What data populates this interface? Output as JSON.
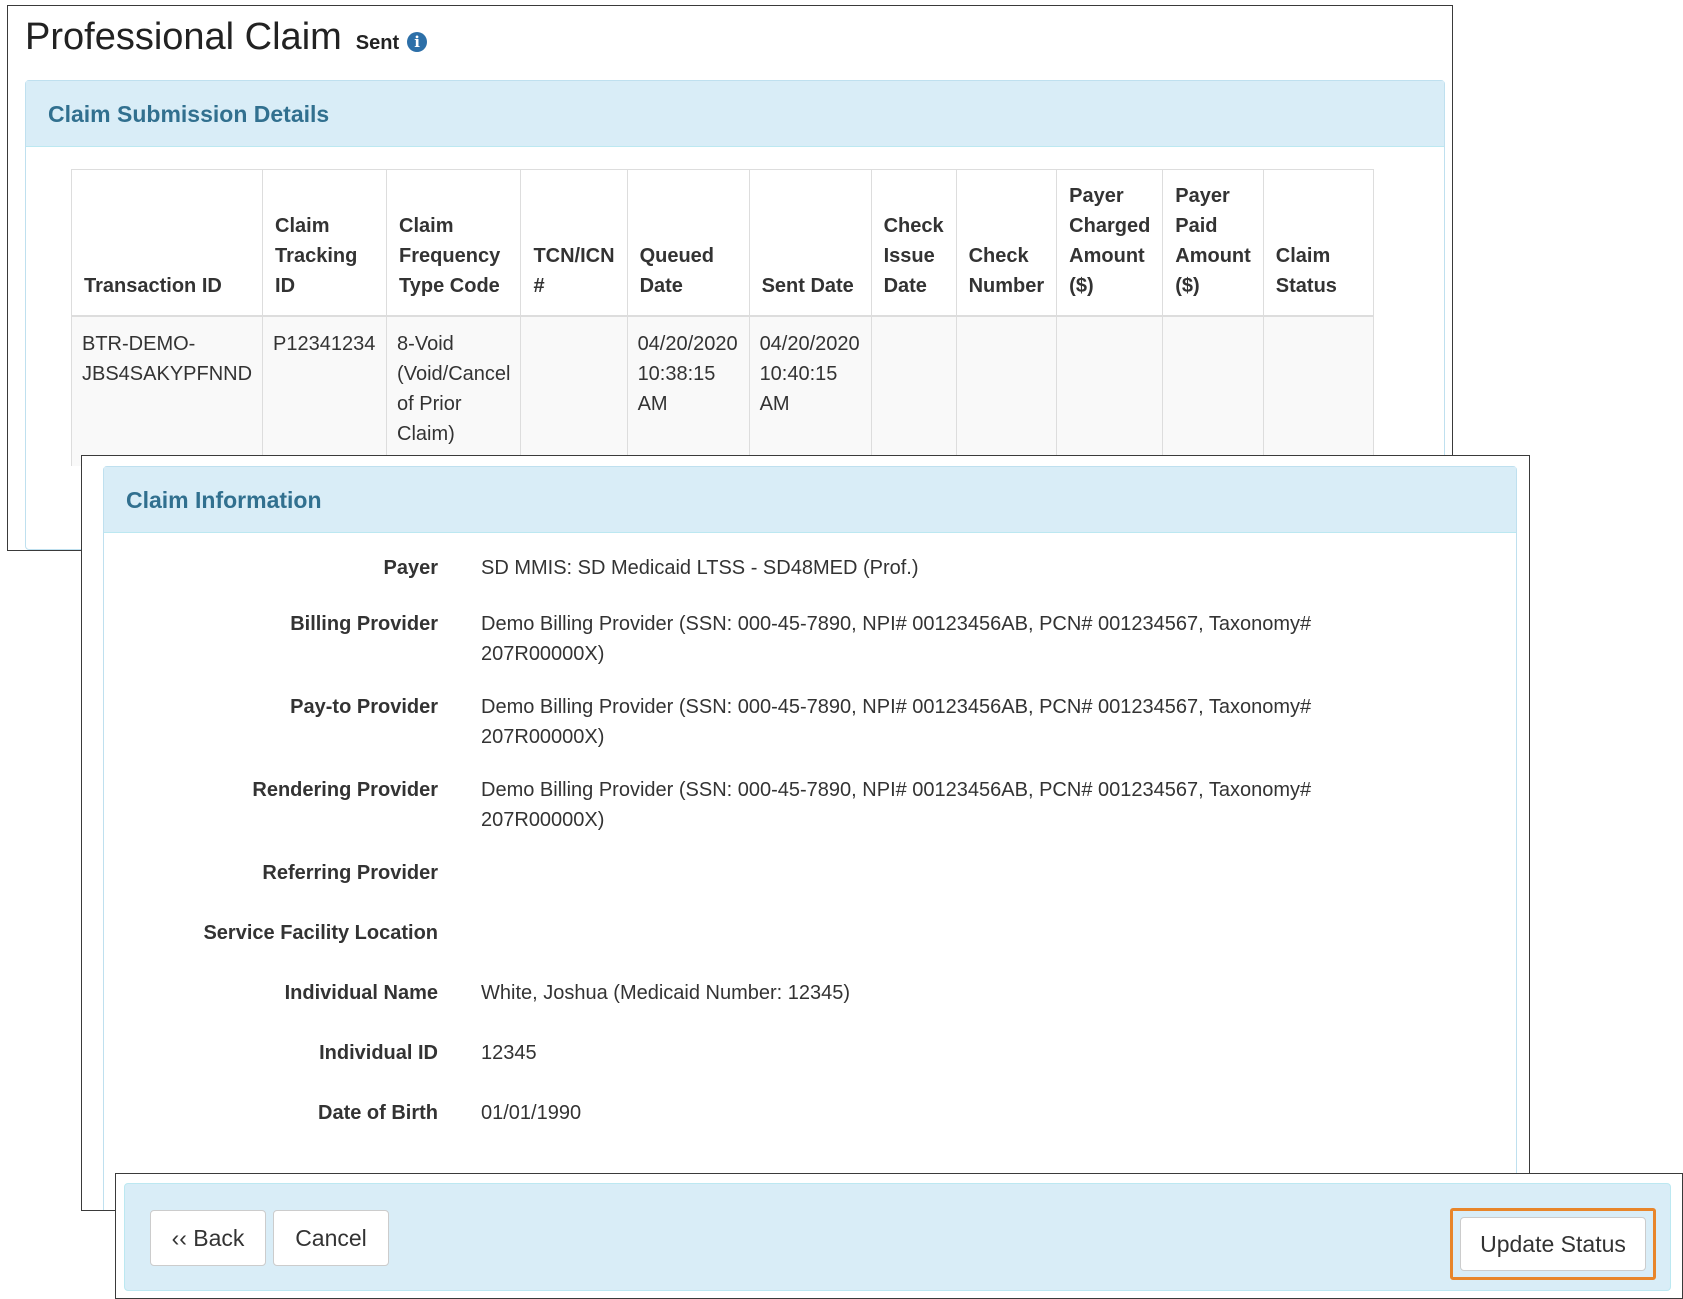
{
  "header": {
    "title": "Professional Claim",
    "status": "Sent",
    "info_icon": "i"
  },
  "submission": {
    "title": "Claim Submission Details",
    "columns": [
      "Transaction ID",
      "Claim Tracking ID",
      "Claim Frequency Type Code",
      "TCN/ICN #",
      "Queued Date",
      "Sent Date",
      "Check Issue Date",
      "Check Number",
      "Payer Charged Amount ($)",
      "Payer Paid Amount ($)",
      "Claim Status"
    ],
    "row": [
      "BTR-DEMO-JBS4SAKYPFNND",
      "P12341234",
      "8-Void (Void/Cancel of Prior Claim)",
      "",
      "04/20/2020 10:38:15 AM",
      "04/20/2020 10:40:15 AM",
      "",
      "",
      "",
      "",
      ""
    ]
  },
  "claim_info": {
    "title": "Claim Information",
    "fields": [
      {
        "label": "Payer",
        "value": "SD MMIS: SD Medicaid LTSS - SD48MED (Prof.)"
      },
      {
        "label": "Billing Provider",
        "value": "Demo Billing Provider (SSN: 000-45-7890, NPI# 00123456AB, PCN# 001234567, Taxonomy# 207R00000X)"
      },
      {
        "label": "Pay-to Provider",
        "value": "Demo Billing Provider (SSN: 000-45-7890, NPI# 00123456AB, PCN# 001234567, Taxonomy# 207R00000X)"
      },
      {
        "label": "Rendering Provider",
        "value": "Demo Billing Provider (SSN: 000-45-7890, NPI# 00123456AB, PCN# 001234567, Taxonomy# 207R00000X)"
      },
      {
        "label": "Referring Provider",
        "value": ""
      },
      {
        "label": "Service Facility Location",
        "value": ""
      },
      {
        "label": "Individual Name",
        "value": "White, Joshua (Medicaid Number: 12345)"
      },
      {
        "label": "Individual ID",
        "value": "12345"
      },
      {
        "label": "Date of Birth",
        "value": "01/01/1990"
      }
    ]
  },
  "actions": {
    "back": "‹‹ Back",
    "cancel": "Cancel",
    "update_status": "Update Status"
  },
  "colors": {
    "panel_bg": "#d9edf7",
    "panel_title": "#31708f",
    "highlight": "#e8852a",
    "info_icon": "#2c6fa8"
  }
}
